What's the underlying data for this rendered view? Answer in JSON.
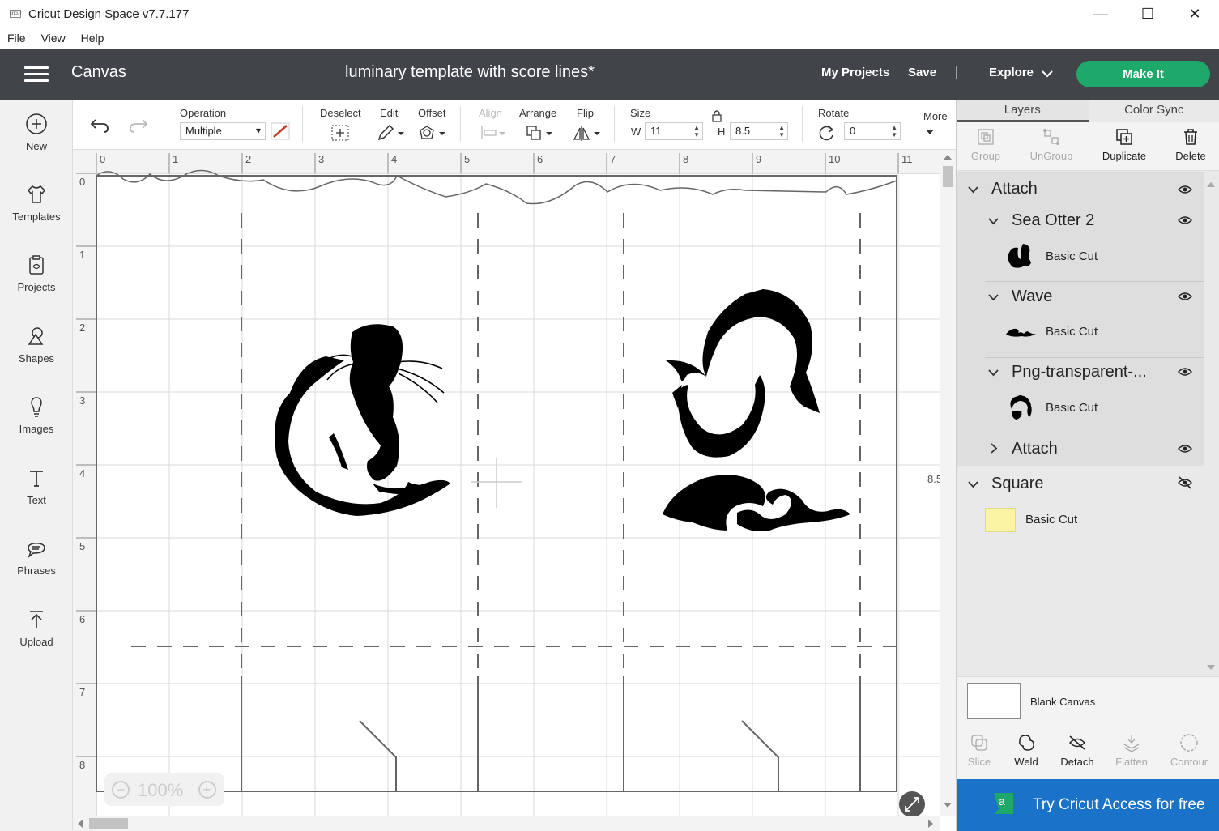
{
  "window": {
    "title": "Cricut Design Space  v7.7.177",
    "logo_text": "cricut",
    "minimize": "—",
    "maximize": "☐",
    "close": "✕"
  },
  "menu": [
    "File",
    "View",
    "Help"
  ],
  "header": {
    "section": "Canvas",
    "project_name": "luminary template with score lines*",
    "my_projects": "My Projects",
    "save": "Save",
    "separator": "|",
    "explore": "Explore",
    "make_it": "Make It",
    "make_it_color": "#1ea86a"
  },
  "sidebar": [
    {
      "label": "New",
      "icon": "plus-circle-icon"
    },
    {
      "label": "Templates",
      "icon": "shirt-icon"
    },
    {
      "label": "Projects",
      "icon": "clipboard-icon"
    },
    {
      "label": "Shapes",
      "icon": "shapes-icon"
    },
    {
      "label": "Images",
      "icon": "bulb-icon"
    },
    {
      "label": "Text",
      "icon": "text-t-icon"
    },
    {
      "label": "Phrases",
      "icon": "speech-bubble-icon"
    },
    {
      "label": "Upload",
      "icon": "upload-arrow-icon"
    }
  ],
  "toolbar": {
    "operation_label": "Operation",
    "operation_value": "Multiple",
    "deselect": "Deselect",
    "edit": "Edit",
    "offset": "Offset",
    "align": "Align",
    "arrange": "Arrange",
    "flip": "Flip",
    "size": "Size",
    "w_label": "W",
    "w_value": "11",
    "h_label": "H",
    "h_value": "8.5",
    "rotate": "Rotate",
    "rotate_value": "0",
    "more": "More"
  },
  "canvas": {
    "ruler_top": [
      "0",
      "1",
      "2",
      "3",
      "4",
      "5",
      "6",
      "7",
      "8",
      "9",
      "10",
      "11"
    ],
    "ruler_left": [
      "0",
      "1",
      "2",
      "3",
      "4",
      "5",
      "6",
      "7",
      "8"
    ],
    "height_marker": "8.5",
    "zoom": "100%",
    "zoom_minus": "−",
    "zoom_plus": "+"
  },
  "layers_panel": {
    "tabs": [
      "Layers",
      "Color Sync"
    ],
    "actions": [
      "Group",
      "UnGroup",
      "Duplicate",
      "Delete"
    ],
    "tree": {
      "attach_group": "Attach",
      "sea_otter": "Sea Otter 2",
      "sea_otter_op": "Basic Cut",
      "wave": "Wave",
      "wave_op": "Basic Cut",
      "png": "Png-transparent-...",
      "png_op": "Basic Cut",
      "attach_collapsed": "Attach",
      "square": "Square",
      "square_op": "Basic Cut",
      "square_color": "#fbf4a4"
    },
    "blank_canvas": "Blank Canvas",
    "bottom_actions": [
      "Slice",
      "Weld",
      "Detach",
      "Flatten",
      "Contour"
    ],
    "access_banner": "Try Cricut Access for free",
    "access_color": "#1a73c9"
  }
}
